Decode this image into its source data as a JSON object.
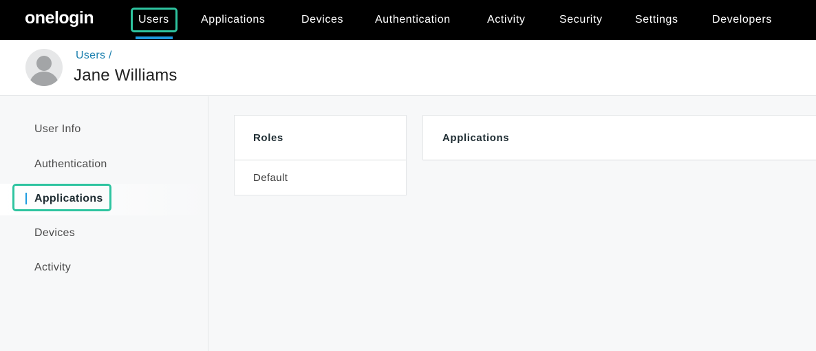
{
  "topnav": {
    "logo": "onelogin",
    "items": [
      "Users",
      "Applications",
      "Devices",
      "Authentication",
      "Activity",
      "Security",
      "Settings",
      "Developers"
    ],
    "active": "Users"
  },
  "header": {
    "breadcrumb": "Users /",
    "title": "Jane Williams",
    "avatar_icon": "user-silhouette-icon"
  },
  "sidebar": {
    "items": [
      "User Info",
      "Authentication",
      "Applications",
      "Devices",
      "Activity"
    ],
    "active": "Applications"
  },
  "roles_panel": {
    "title": "Roles",
    "items": [
      "Default"
    ]
  },
  "applications_panel": {
    "title": "Applications"
  },
  "colors": {
    "nav_bg": "#000000",
    "highlight": "#2ec4a0",
    "accent_blue": "#1d9be0",
    "link": "#1b7fae"
  }
}
